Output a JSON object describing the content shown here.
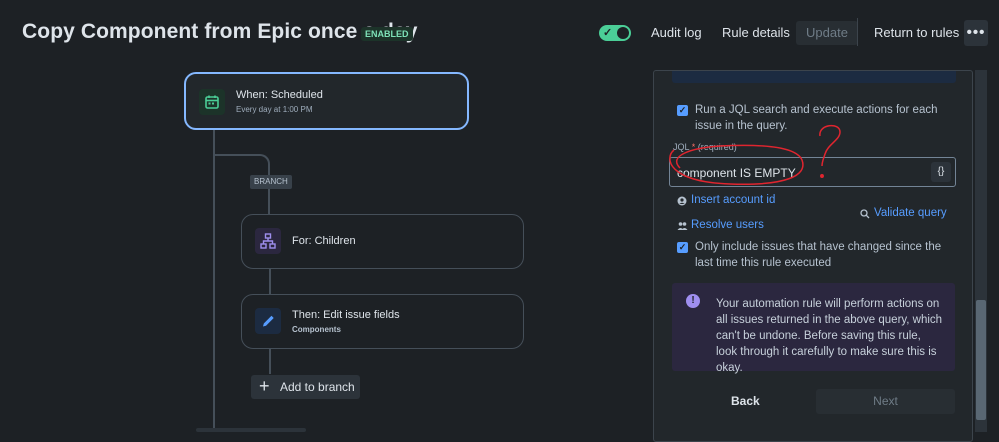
{
  "header": {
    "title": "Copy Component from Epic once a day",
    "status_badge": "ENABLED",
    "audit_log": "Audit log",
    "rule_details": "Rule details",
    "update": "Update",
    "return_to_rules": "Return to rules",
    "more": "•••",
    "toggle_on": true
  },
  "flow": {
    "trigger": {
      "title": "When: Scheduled",
      "subtitle": "Every day at 1:00 PM",
      "icon": "calendar-icon"
    },
    "branch_label": "BRANCH",
    "branch_card": {
      "title": "For: Children",
      "icon": "hierarchy-icon"
    },
    "action_card": {
      "title": "Then: Edit issue fields",
      "subtitle": "Components",
      "icon": "pencil-icon"
    },
    "add_to_branch": "Add to branch"
  },
  "panel": {
    "run_jql_label": "Run a JQL search and execute actions for each issue in the query.",
    "jql_label": "JQL",
    "jql_required_marker": "*",
    "jql_required_text": "(required)",
    "jql_value": "component IS EMPTY",
    "jql_brace_button": "{}",
    "insert_account_id": "Insert account id",
    "resolve_users": "Resolve users",
    "validate_query": "Validate query",
    "only_changed_label": "Only include issues that have changed since the last time this rule executed",
    "info_message": "Your automation rule will perform actions on all issues returned in the above query, which can't be undone. Before saving this rule, look through it carefully to make sure this is okay.",
    "back": "Back",
    "next": "Next"
  },
  "annotation": {
    "color": "#e0252f"
  }
}
